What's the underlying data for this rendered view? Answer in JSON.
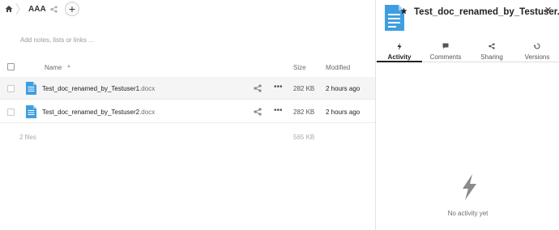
{
  "breadcrumb": {
    "folder": "AAA"
  },
  "notes_placeholder": "Add notes, lists or links ...",
  "table": {
    "col_name": "Name",
    "col_size": "Size",
    "col_modified": "Modified"
  },
  "files": [
    {
      "base": "Test_doc_renamed_by_Testuser1",
      "ext": ".docx",
      "size": "282 KB",
      "modified": "2 hours ago"
    },
    {
      "base": "Test_doc_renamed_by_Testuser2",
      "ext": ".docx",
      "size": "282 KB",
      "modified": "2 hours ago"
    }
  ],
  "summary": {
    "count": "2 files",
    "total": "565 KB"
  },
  "sidebar": {
    "title": "Test_doc_renamed_by_Testuser...",
    "tabs": [
      {
        "label": "Activity",
        "icon": "lightning-icon"
      },
      {
        "label": "Comments",
        "icon": "comment-icon"
      },
      {
        "label": "Sharing",
        "icon": "share-icon"
      },
      {
        "label": "Versions",
        "icon": "history-icon"
      }
    ],
    "empty_text": "No activity yet"
  },
  "colors": {
    "file_icon": "#3e9fe0",
    "active_tab": "#222222"
  },
  "icons": [
    "home-icon",
    "share-icon",
    "plus-icon",
    "more-icon",
    "close-icon",
    "star-icon",
    "lightning-icon"
  ]
}
